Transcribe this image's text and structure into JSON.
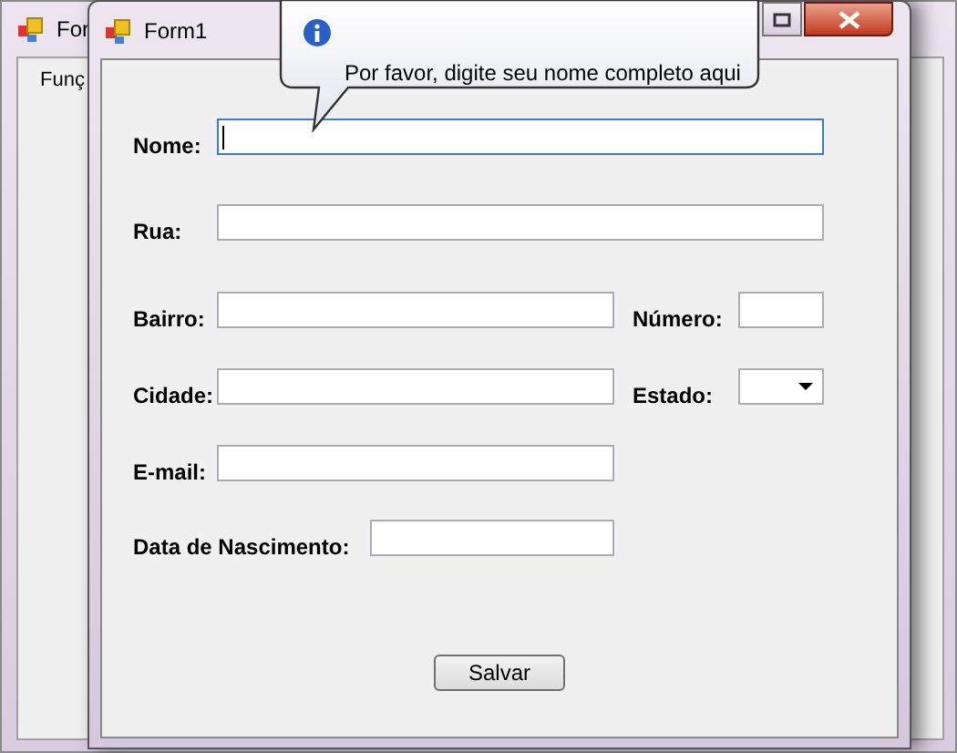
{
  "back_window": {
    "title": "For",
    "menu": [
      "Funç"
    ]
  },
  "window": {
    "title": "Form1"
  },
  "tooltip": {
    "text": "Por favor, digite seu nome completo aqui"
  },
  "rows": [
    {
      "fields": [
        {
          "label": "Nome:",
          "kind": "text",
          "focused": true
        }
      ]
    },
    {
      "fields": [
        {
          "label": "Rua:",
          "kind": "text",
          "focused": false
        }
      ]
    },
    {
      "fields": [
        {
          "label": "Bairro:",
          "kind": "text",
          "focused": false
        },
        {
          "label": "Número:",
          "kind": "text",
          "focused": false
        }
      ]
    },
    {
      "fields": [
        {
          "label": "Cidade:",
          "kind": "text",
          "focused": false
        },
        {
          "label": "Estado:",
          "kind": "combo",
          "focused": false
        }
      ]
    },
    {
      "fields": [
        {
          "label": "E-mail:",
          "kind": "text",
          "focused": false
        }
      ]
    },
    {
      "fields": [
        {
          "label": "Data de Nascimento:",
          "kind": "text",
          "focused": false
        }
      ]
    }
  ],
  "button": "Salvar"
}
